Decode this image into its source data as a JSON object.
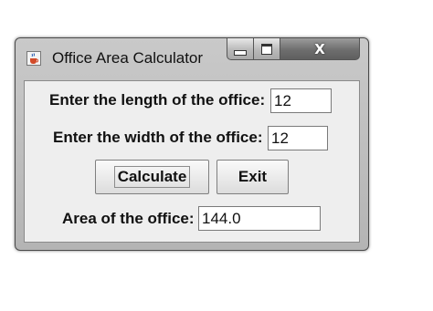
{
  "window": {
    "title": "Office Area Calculator",
    "close_glyph": "X",
    "icons": [
      "java-cup-icon",
      "minimize-icon",
      "maximize-icon",
      "close-icon"
    ]
  },
  "form": {
    "length_label": "Enter the length of the office:",
    "length_value": "12",
    "width_label": "Enter the width of the office:",
    "width_value": "12",
    "calculate_label": "Calculate",
    "exit_label": "Exit",
    "area_label": "Area of the office:",
    "area_value": "144.0"
  }
}
